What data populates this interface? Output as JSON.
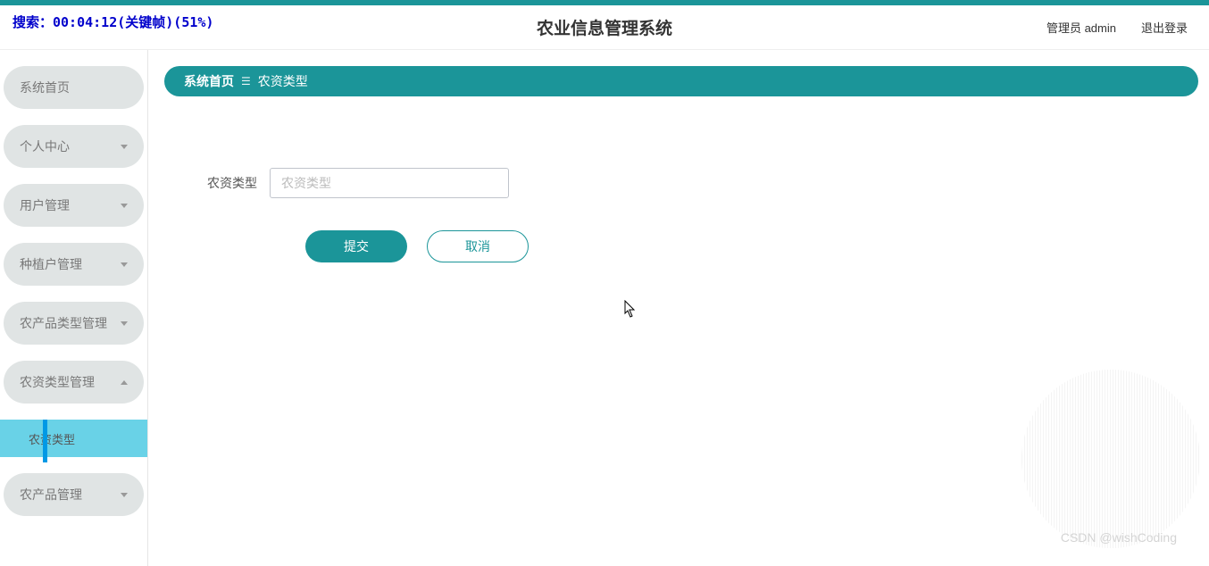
{
  "overlay": "搜索：00:04:12(关键帧)(51%)",
  "header": {
    "title": "农业信息管理系统",
    "user_label": "管理员 admin",
    "logout_label": "退出登录"
  },
  "sidebar": {
    "items": [
      {
        "label": "系统首页",
        "type": "plain"
      },
      {
        "label": "个人中心",
        "type": "expandable"
      },
      {
        "label": "用户管理",
        "type": "expandable"
      },
      {
        "label": "种植户管理",
        "type": "expandable"
      },
      {
        "label": "农产品类型管理",
        "type": "expandable"
      },
      {
        "label": "农资类型管理",
        "type": "expanded",
        "children": [
          {
            "label": "农资类型"
          }
        ]
      },
      {
        "label": "农产品管理",
        "type": "expandable"
      }
    ]
  },
  "breadcrumb": {
    "home": "系统首页",
    "sep": "☰",
    "current": "农资类型"
  },
  "form": {
    "field_label": "农资类型",
    "field_placeholder": "农资类型",
    "field_value": "",
    "submit_label": "提交",
    "cancel_label": "取消"
  },
  "watermark": "CSDN @wishCoding"
}
